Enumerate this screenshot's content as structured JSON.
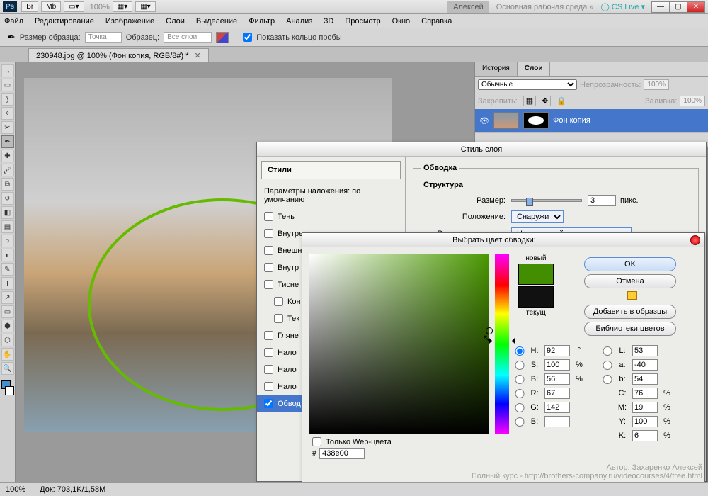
{
  "top": {
    "app": "Ps",
    "br": "Br",
    "mb": "Mb",
    "zoom": "100%",
    "user": "Алексей",
    "workspace": "Основная рабочая среда",
    "cslive": "CS Live"
  },
  "menu": [
    "Файл",
    "Редактирование",
    "Изображение",
    "Слои",
    "Выделение",
    "Фильтр",
    "Анализ",
    "3D",
    "Просмотр",
    "Окно",
    "Справка"
  ],
  "opt": {
    "sample_label": "Размер образца:",
    "sample_value": "Точка",
    "target_label": "Образец:",
    "target_value": "Все слои",
    "checkbox": "Показать кольцо пробы"
  },
  "doc_tab": "230948.jpg @ 100% (Фон копия, RGB/8#) *",
  "panels": {
    "tabs": [
      "История",
      "Слои"
    ],
    "blend": "Обычные",
    "opacity_label": "Непрозрачность:",
    "opacity": "100%",
    "fill_label": "Заливка:",
    "fill": "100%",
    "layer_active": "Фон копия"
  },
  "styledlg": {
    "title": "Стиль слоя",
    "styles_header": "Стили",
    "blend_header": "Параметры наложения: по умолчанию",
    "items": [
      "Тень",
      "Внутренняя тень",
      "Внешн",
      "Внутр",
      "Тисне",
      "Кон",
      "Тек",
      "Гляне",
      "Нало",
      "Нало",
      "Нало",
      "Обвод"
    ],
    "group": "Обводка",
    "struct": "Структура",
    "size_label": "Размер:",
    "size_value": "3",
    "size_unit": "пикс.",
    "pos_label": "Положение:",
    "pos_value": "Снаружи",
    "blend_label": "Режим наложения:",
    "blend_value": "Нормальный"
  },
  "cp": {
    "title": "Выбрать цвет обводки:",
    "new_label": "новый",
    "cur_label": "текущ",
    "ok": "OK",
    "cancel": "Отмена",
    "add": "Добавить в образцы",
    "libs": "Библиотеки цветов",
    "H": "92",
    "S": "100",
    "Bv": "56",
    "R": "67",
    "G": "142",
    "Bc": "",
    "L": "53",
    "a": "-40",
    "b": "54",
    "C": "76",
    "M": "19",
    "Y": "100",
    "K": "6",
    "deg": "°",
    "pct": "%",
    "webonly": "Только Web-цвета",
    "hex": "438e00"
  },
  "status": {
    "zoom": "100%",
    "doc": "Док: 703,1K/1,58M"
  },
  "watermark": {
    "author": "Автор: Захаренко Алексей",
    "url": "Полный курс - http://brothers-company.ru/videocourses/4/free.html"
  }
}
